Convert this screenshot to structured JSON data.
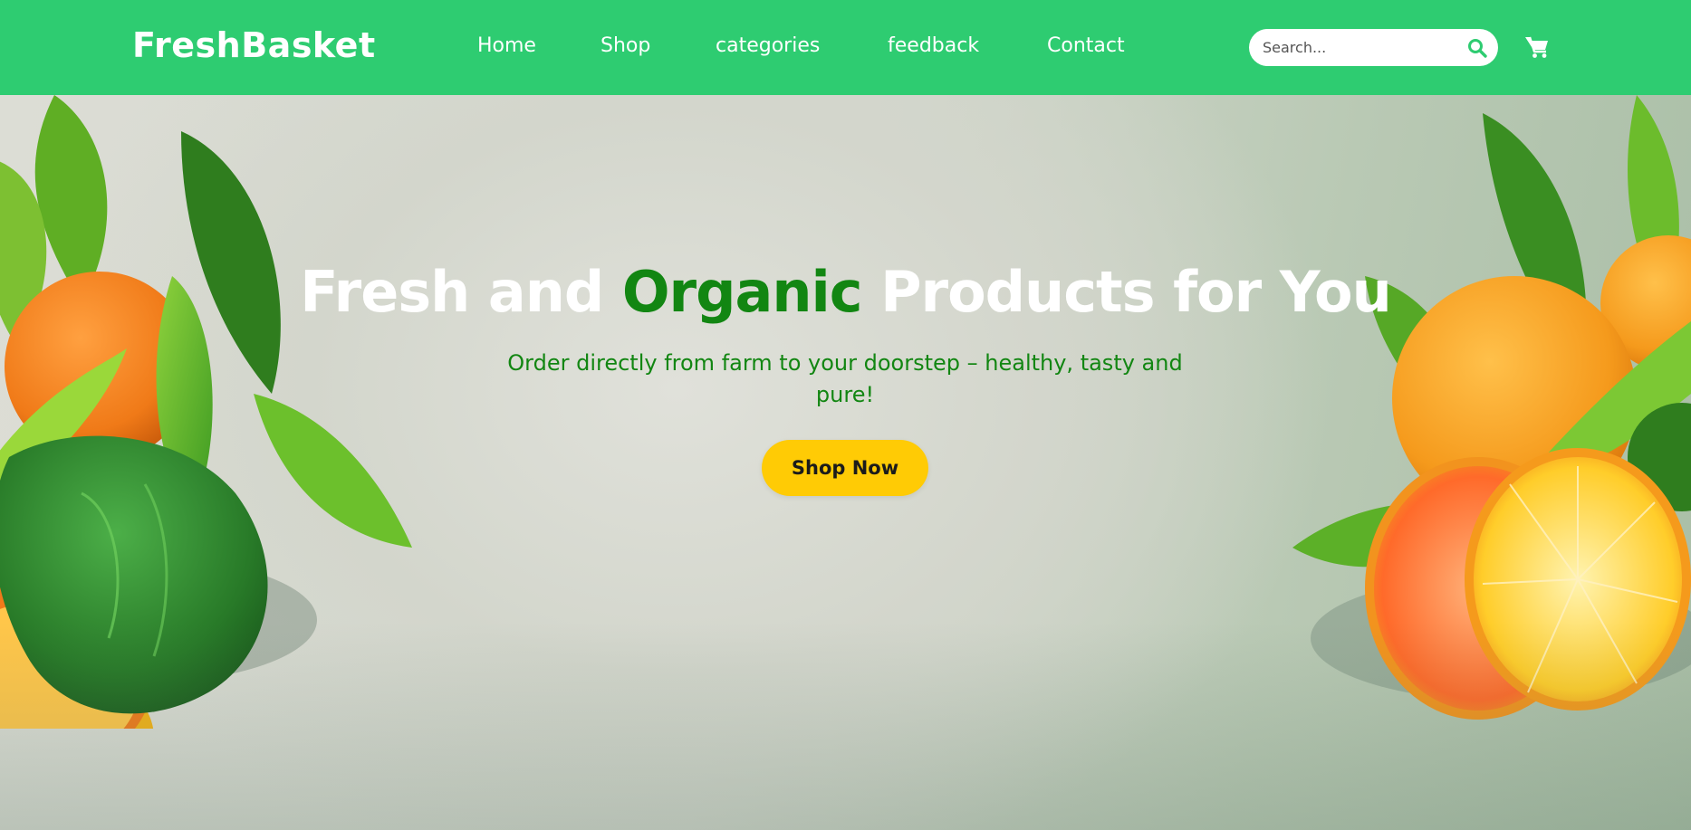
{
  "brand": {
    "name": "FreshBasket"
  },
  "nav": {
    "items": [
      {
        "label": "Home"
      },
      {
        "label": "Shop"
      },
      {
        "label": "categories"
      },
      {
        "label": "feedback"
      },
      {
        "label": "Contact"
      }
    ]
  },
  "search": {
    "placeholder": "Search..."
  },
  "icons": {
    "search": "search-icon",
    "cart": "shopping-cart-icon"
  },
  "hero": {
    "headline_pre": "Fresh and ",
    "headline_accent": "Organic",
    "headline_post": " Products for You",
    "subtitle": "Order directly from farm to your doorstep – healthy, tasty and pure!",
    "cta_label": "Shop Now"
  },
  "colors": {
    "navbar": "#2ecc71",
    "accent_green": "#128612",
    "cta": "#ffcb05",
    "text_on_nav": "#ffffff"
  }
}
